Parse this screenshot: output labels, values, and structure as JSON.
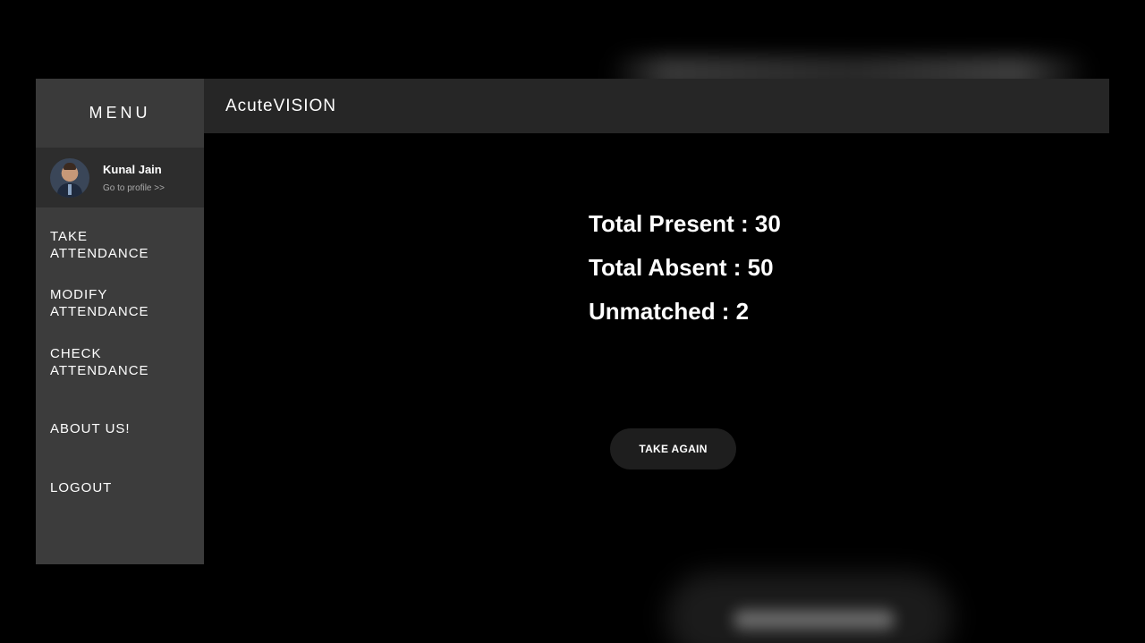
{
  "app": {
    "brand": "AcuteVISION"
  },
  "sidebar": {
    "menu_title": "MENU",
    "profile": {
      "name": "Kunal Jain",
      "link_label": "Go to profile >>"
    },
    "items": [
      {
        "label": "TAKE\nATTENDANCE"
      },
      {
        "label": "MODIFY\nATTENDANCE"
      },
      {
        "label": "CHECK\nATTENDANCE"
      },
      {
        "label": "ABOUT US!"
      },
      {
        "label": "LOGOUT"
      }
    ]
  },
  "stats": {
    "present_label": "Total Present : 30",
    "absent_label": "Total Absent : 50",
    "unmatched_label": "Unmatched : 2"
  },
  "actions": {
    "take_again_label": "TAKE AGAIN"
  },
  "colors": {
    "background": "#000000",
    "sidebar": "#3c3c3c",
    "profile_band": "#2d2d2d",
    "topbar": "#262626",
    "button": "#1e1e1e",
    "text": "#ffffff"
  }
}
